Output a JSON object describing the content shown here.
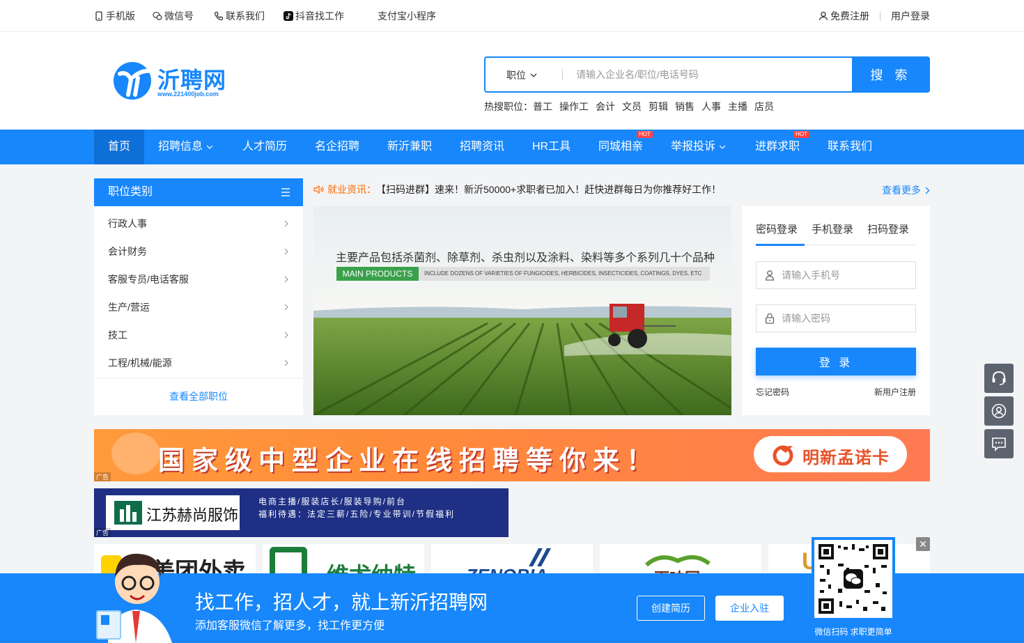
{
  "topbar": {
    "mobile": "手机版",
    "wechat": "微信号",
    "contact": "联系我们",
    "douyin": "抖音找工作",
    "alipay": "支付宝小程序",
    "register": "免费注册",
    "login": "用户登录"
  },
  "logo": {
    "name": "沂聘网",
    "url_text": "www.221400job.com"
  },
  "search": {
    "type_label": "职位",
    "placeholder": "请输入企业名/职位/电话号码",
    "button": "搜 索"
  },
  "hot_search": {
    "label": "热搜职位：",
    "items": [
      "普工",
      "操作工",
      "会计",
      "文员",
      "剪辑",
      "销售",
      "人事",
      "主播",
      "店员"
    ]
  },
  "nav": {
    "items": [
      {
        "label": "首页"
      },
      {
        "label": "招聘信息"
      },
      {
        "label": "人才简历"
      },
      {
        "label": "名企招聘"
      },
      {
        "label": "新沂兼职"
      },
      {
        "label": "招聘资讯"
      },
      {
        "label": "HR工具"
      },
      {
        "label": "同城相亲",
        "badge": "HOT"
      },
      {
        "label": "举报投诉"
      },
      {
        "label": "进群求职",
        "badge": "HOT"
      },
      {
        "label": "联系我们"
      }
    ]
  },
  "category": {
    "title": "职位类别",
    "items": [
      "行政人事",
      "会计财务",
      "客服专员/电话客服",
      "生产/营运",
      "技工",
      "工程/机械/能源"
    ],
    "more": "查看全部职位"
  },
  "news": {
    "label": "就业资讯：",
    "text": "【扫码进群】速来！新沂50000+求职者已加入！赶快进群每日为你推荐好工作！",
    "more": "查看更多"
  },
  "banner": {
    "headline": "主要产品包括杀菌剂、除草剂、杀虫剂以及涂料、染料等多个系列几十个品种",
    "tag": "MAIN PRODUCTS",
    "tag_sub": "INCLUDE DOZENS OF VARIETIES OF FUNGICIDES, HERBICIDES, INSECTICIDES, COATINGS, DYES, ETC"
  },
  "login": {
    "tabs": [
      "密码登录",
      "手机登录",
      "扫码登录"
    ],
    "phone_placeholder": "请输入手机号",
    "password_placeholder": "请输入密码",
    "button": "登 录",
    "forgot": "忘记密码",
    "new_user": "新用户注册"
  },
  "ad1": {
    "text": "国家级中型企业在线招聘等你来！",
    "brand": "明新孟诺卡",
    "tag": "广告"
  },
  "ad2": {
    "company": "江苏赫尚服饰",
    "line1": "电商主播/服装店长/服装导购/前台",
    "line2": "福利待遇：法定三薪/五险/专业带训/节假福利",
    "tag": "广告"
  },
  "logos": [
    "美团外卖",
    "维尤纳特",
    "ZENOBIA",
    "百味园",
    "U"
  ],
  "bottom": {
    "title": "找工作，招人才，就上新沂招聘网",
    "subtitle": "添加客服微信了解更多，找工作更方便",
    "btn_resume": "创建简历",
    "btn_company": "企业入驻",
    "qr_caption": "微信扫码 求职更简单",
    "close": "✕"
  },
  "colors": {
    "primary": "#1787fb",
    "accent": "#ff6a00",
    "hot": "#ff4444"
  }
}
